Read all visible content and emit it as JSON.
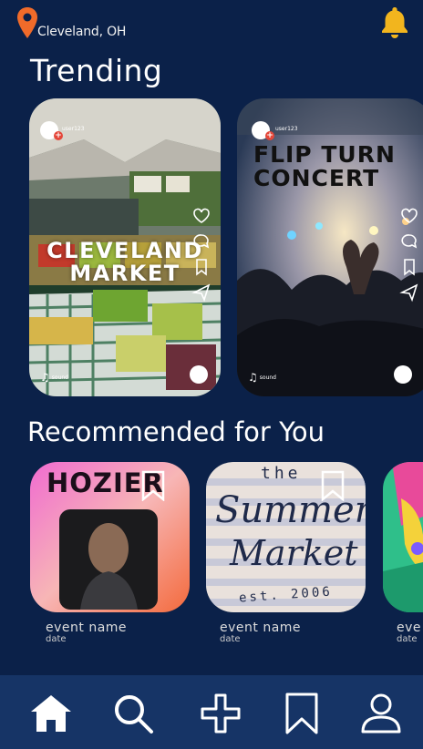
{
  "location": {
    "city": "Cleveland, OH"
  },
  "sections": {
    "trending": "Trending",
    "recommended": "Recommended for You"
  },
  "trending": [
    {
      "title_line1": "CLEVELAND",
      "title_line2": "MARKET",
      "user": "user123",
      "sound": "sound"
    },
    {
      "title_line1": "FLIP TURN",
      "title_line2": "CONCERT",
      "user": "user123",
      "sound": "sound"
    }
  ],
  "recommended": [
    {
      "poster_text": "HOZIER",
      "name": "event name",
      "date": "date"
    },
    {
      "poster_line1": "the",
      "poster_line2": "Summer",
      "poster_line3": "Market",
      "poster_line4": "est. 2006",
      "name": "event name",
      "date": "date"
    },
    {
      "name": "eve",
      "date": "date"
    }
  ],
  "colors": {
    "background": "#0b2149",
    "nav": "#163466",
    "bell": "#f2b51e",
    "pin": "#f06b2a"
  },
  "icons": [
    "pin-icon",
    "bell-icon",
    "heart-icon",
    "comment-icon",
    "bookmark-icon",
    "send-icon",
    "more-icon",
    "music-note-icon",
    "home-icon",
    "search-icon",
    "add-icon",
    "bookmark-nav-icon",
    "profile-icon"
  ]
}
